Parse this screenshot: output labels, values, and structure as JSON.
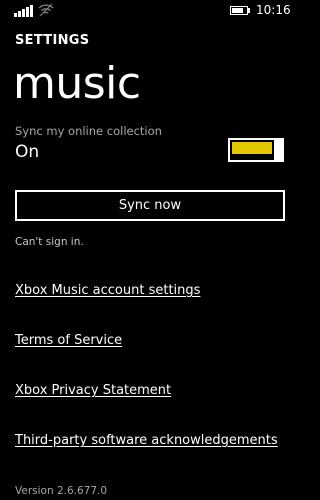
{
  "status_bar": {
    "time": "10:16",
    "signal_icon": "signal-strength-icon",
    "wifi_icon": "wifi-icon",
    "battery_icon": "battery-icon",
    "battery_level": 0.85
  },
  "header": {
    "app_title": "SETTINGS",
    "page_title": "music"
  },
  "sync_toggle": {
    "label": "Sync my online collection",
    "state_text": "On",
    "on": true,
    "accent_color": "#e3c800"
  },
  "sync_button": {
    "label": "Sync now"
  },
  "account_status": "Can't sign in.",
  "links": [
    "Xbox Music account settings",
    "Terms of Service",
    "Xbox Privacy Statement",
    "Third-party software acknowledgements"
  ],
  "version": "Version 2.6.677.0"
}
